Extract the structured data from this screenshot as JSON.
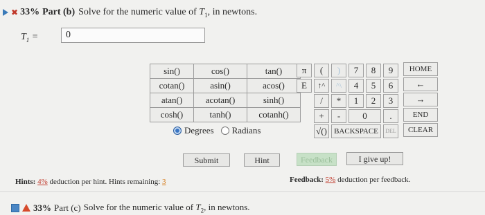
{
  "part_b": {
    "percent": "33%",
    "part_label": "Part (b)",
    "prompt_before": "Solve for the numeric value of ",
    "var": "T",
    "var_sub": "1",
    "prompt_after": ", in newtons."
  },
  "answer": {
    "label_var": "T",
    "label_sub": "1",
    "label_eq": " =",
    "value": "0"
  },
  "functions": {
    "row1": [
      "sin()",
      "cos()",
      "tan()"
    ],
    "row2": [
      "cotan()",
      "asin()",
      "acos()"
    ],
    "row3": [
      "atan()",
      "acotan()",
      "sinh()"
    ],
    "row4": [
      "cosh()",
      "tanh()",
      "cotanh()"
    ]
  },
  "angle_mode": {
    "degrees": "Degrees",
    "radians": "Radians",
    "selected": "Degrees"
  },
  "keypad": {
    "pi": "π",
    "open_paren": "(",
    "close_paren": ")",
    "k7": "7",
    "k8": "8",
    "k9": "9",
    "home": "HOME",
    "e": "E",
    "pow": "↑^",
    "caret": "^\\",
    "k4": "4",
    "k5": "5",
    "k6": "6",
    "left": "←",
    "slash": "/",
    "star": "*",
    "k1": "1",
    "k2": "2",
    "k3": "3",
    "right": "→",
    "plus": "+",
    "minus": "-",
    "k0": "0",
    "dot": ".",
    "end": "END",
    "sqrt": "√()",
    "backspace": "BACKSPACE",
    "del": "DEL",
    "clear": "CLEAR"
  },
  "buttons": {
    "submit": "Submit",
    "hint": "Hint",
    "feedback": "Feedback",
    "give_up": "I give up!"
  },
  "hints": {
    "label": "Hints:",
    "pct": "4%",
    "text": " deduction per hint. Hints remaining: ",
    "remaining": "3"
  },
  "feedback_info": {
    "label": "Feedback:",
    "pct": "5%",
    "text": " deduction per feedback."
  },
  "part_c": {
    "percent": "33%",
    "part_label": "Part (c)",
    "prompt_before": "Solve for the numeric value of ",
    "var": "T",
    "var_sub": "2",
    "prompt_after": ", in newtons."
  },
  "colors": {
    "accent_blue": "#3a7ab8",
    "error_red": "#c0392b",
    "hint_orange": "#d67a18",
    "feedback_green": "#c7e1c7"
  }
}
